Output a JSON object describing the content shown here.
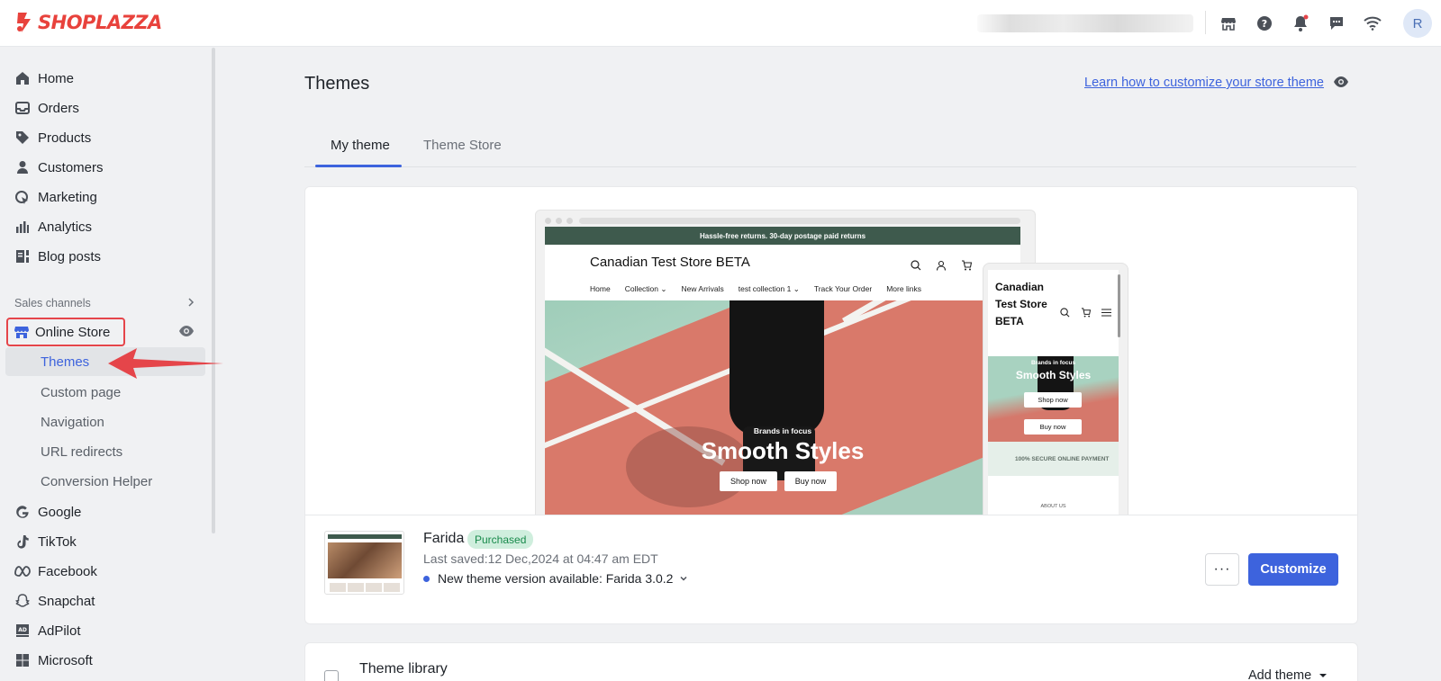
{
  "brand": {
    "name": "SHOPLAZZA",
    "color": "#e8423c"
  },
  "topbar": {
    "icons": [
      "store-icon",
      "help-icon",
      "bell-icon",
      "chat-icon",
      "wifi-icon"
    ],
    "avatar_initial": "R"
  },
  "sidebar": {
    "items": [
      {
        "label": "Home",
        "icon": "home-icon"
      },
      {
        "label": "Orders",
        "icon": "inbox-icon"
      },
      {
        "label": "Products",
        "icon": "tag-icon"
      },
      {
        "label": "Customers",
        "icon": "person-icon"
      },
      {
        "label": "Marketing",
        "icon": "marketing-icon"
      },
      {
        "label": "Analytics",
        "icon": "bar-chart-icon"
      },
      {
        "label": "Blog posts",
        "icon": "blog-icon"
      }
    ],
    "sales_channels_label": "Sales channels",
    "online_store": "Online Store",
    "sub_items": [
      "Themes",
      "Custom page",
      "Navigation",
      "URL redirects",
      "Conversion Helper"
    ],
    "channels": [
      {
        "label": "Google",
        "icon": "google-icon"
      },
      {
        "label": "TikTok",
        "icon": "tiktok-icon"
      },
      {
        "label": "Facebook",
        "icon": "meta-icon"
      },
      {
        "label": "Snapchat",
        "icon": "snapchat-icon"
      },
      {
        "label": "AdPilot",
        "icon": "adpilot-icon"
      },
      {
        "label": "Microsoft",
        "icon": "microsoft-icon"
      }
    ],
    "accent_color": "#3d63dd",
    "annotation_color": "#e5454a"
  },
  "main": {
    "title": "Themes",
    "learn_link": "Learn how to customize your store theme",
    "tabs": [
      {
        "label": "My theme",
        "active": true
      },
      {
        "label": "Theme Store",
        "active": false
      }
    ]
  },
  "preview": {
    "announcement": "Hassle-free returns. 30-day postage paid returns",
    "store_name": "Canadian Test Store BETA",
    "nav": [
      "Home",
      "Collection",
      "New Arrivals",
      "test collection 1",
      "Track Your Order",
      "More links"
    ],
    "hero_sub": "Brands in focus",
    "hero_title": "Smooth Styles",
    "btn_shop": "Shop now",
    "btn_buy": "Buy now",
    "mobile_name": "Canadian Test Store BETA",
    "mobile_strip": "100% SECURE ONLINE PAYMENT",
    "mobile_about": "ABOUT US"
  },
  "theme": {
    "name": "Farida",
    "badge": "Purchased",
    "last_saved": "Last saved:12 Dec,2024 at 04:47 am EDT",
    "version_notice": "New theme version available: Farida 3.0.2",
    "more_label": "···",
    "customize_label": "Customize"
  },
  "library": {
    "title": "Theme library",
    "add_label": "Add theme"
  }
}
